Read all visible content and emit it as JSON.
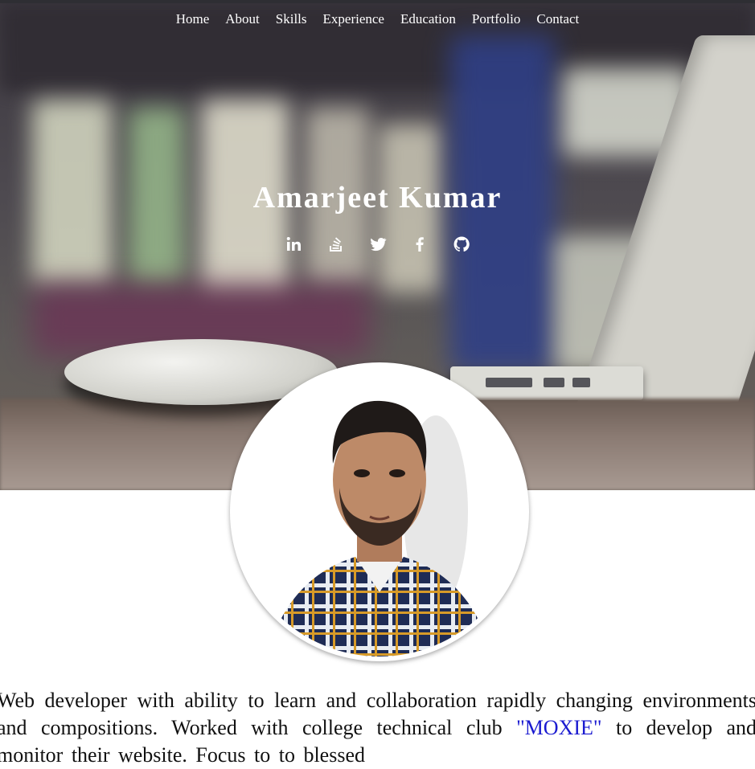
{
  "nav": {
    "items": [
      "Home",
      "About",
      "Skills",
      "Experience",
      "Education",
      "Portfolio",
      "Contact"
    ]
  },
  "hero": {
    "name": "Amarjeet Kumar",
    "socials": [
      "linkedin-icon",
      "stackoverflow-icon",
      "twitter-icon",
      "facebook-icon",
      "github-icon"
    ]
  },
  "bio": {
    "line1": "Web developer with ability to learn and collaboration rapidly changing",
    "line2": "environments and compositions. Worked with college technical club",
    "club_link": "\"MOXIE\"",
    "line3_rest": " to develop and monitor their website. Focus to to blessed"
  },
  "colors": {
    "nav_text": "#ffffff",
    "link": "#1a1ad0",
    "text": "#111111"
  }
}
